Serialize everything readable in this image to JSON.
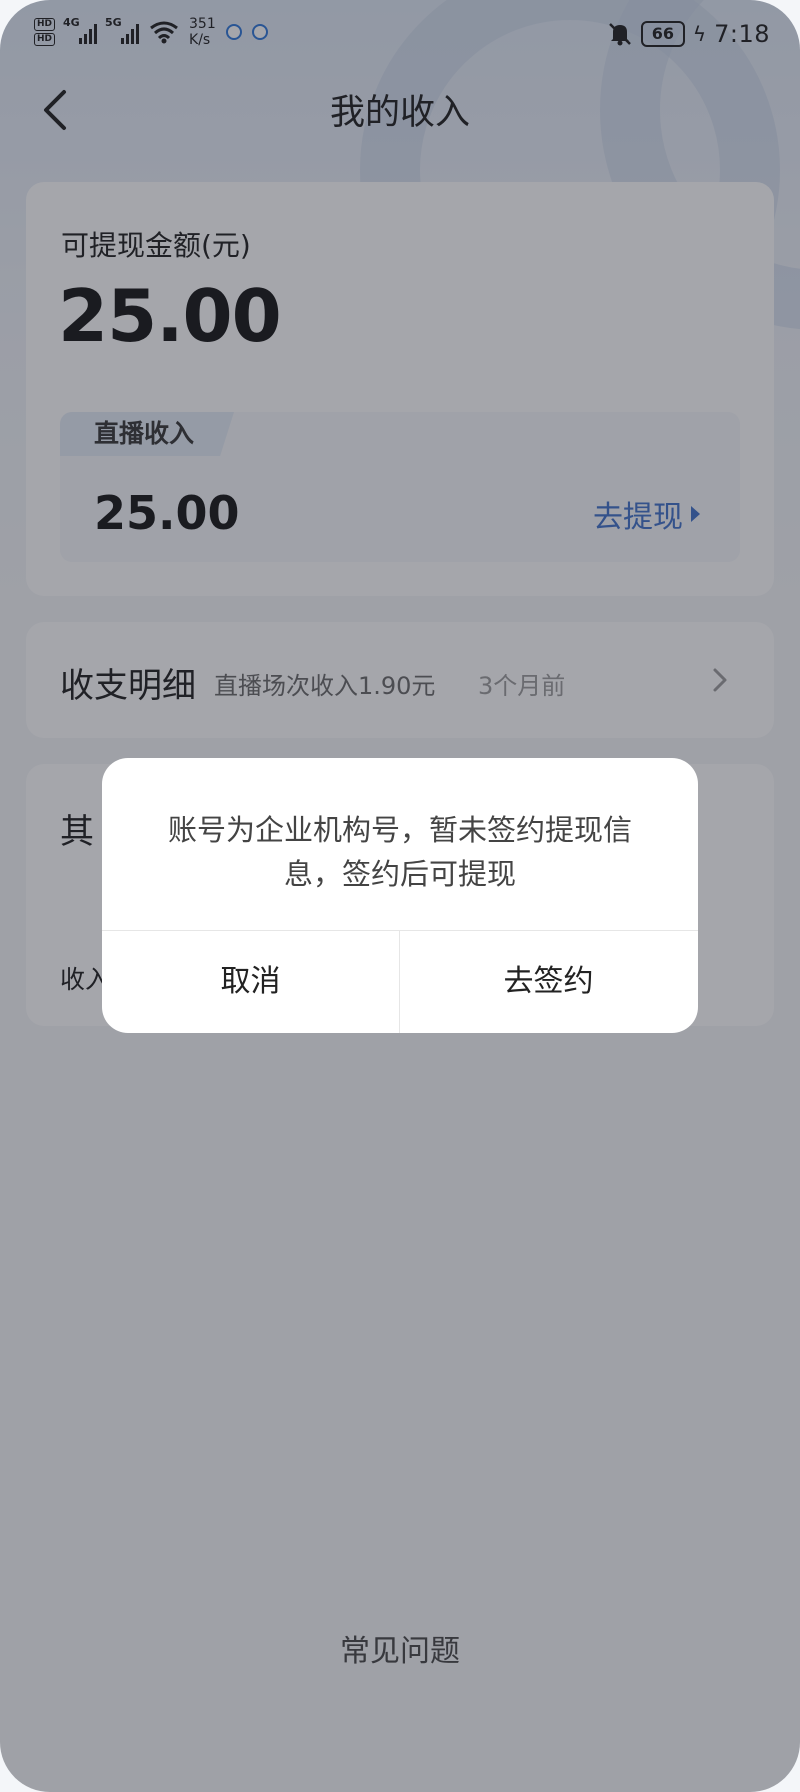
{
  "status_bar": {
    "hd1": "HD",
    "hd2": "HD",
    "net1": "4G",
    "net2": "5G",
    "speed_value": "351",
    "speed_unit": "K/s",
    "battery": "66",
    "time": "7:18"
  },
  "header": {
    "title": "我的收入"
  },
  "balance": {
    "label": "可提现金额(元)",
    "amount": "25.00",
    "live": {
      "tag": "直播收入",
      "amount": "25.00",
      "withdraw_label": "去提现"
    }
  },
  "details": {
    "title": "收支明细",
    "latest": "直播场次收入1.90元",
    "time": "3个月前"
  },
  "other": {
    "title_partial": "其",
    "label_partial": "收入"
  },
  "faq": {
    "label": "常见问题"
  },
  "dialog": {
    "message": "账号为企业机构号，暂未签约提现信息，签约后可提现",
    "cancel_label": "取消",
    "confirm_label": "去签约"
  },
  "colors": {
    "accent": "#3d6fc9",
    "overlay": "rgba(40,44,56,0.42)"
  }
}
